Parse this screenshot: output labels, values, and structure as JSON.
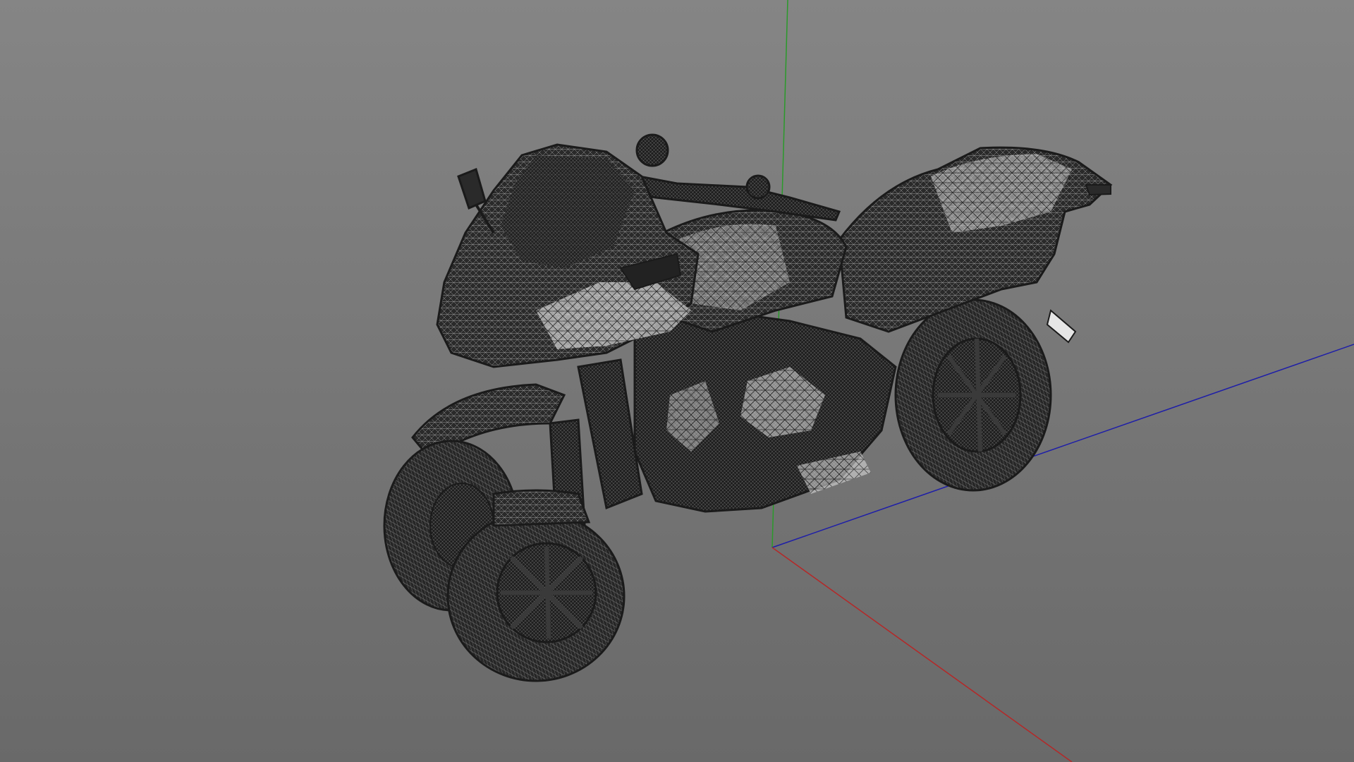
{
  "viewport": {
    "background_top": "#858585",
    "background_bottom": "#696969",
    "mesh_color": "#232323",
    "mesh_highlight": "#f2f2f2",
    "display_mode": "wireframe"
  },
  "axes": {
    "x_color": "#b52828",
    "y_color": "#2a9a2a",
    "z_color": "#1e1ea8"
  },
  "model": {
    "icon": "three-wheeled-motorcycle-wireframe"
  }
}
